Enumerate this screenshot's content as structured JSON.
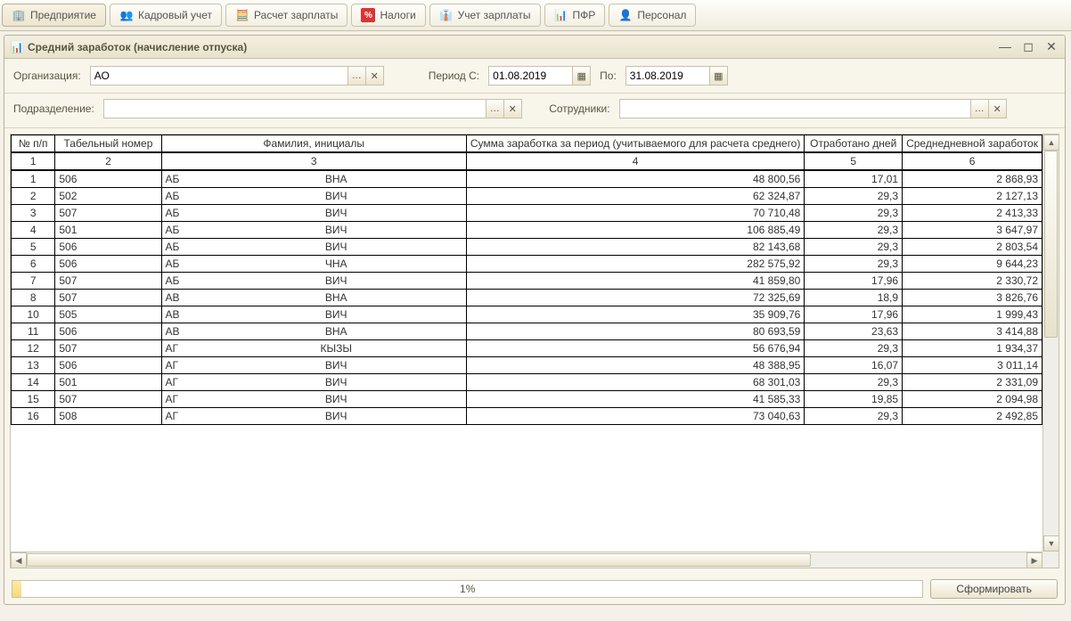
{
  "tabs": [
    {
      "label": "Предприятие",
      "icon": "🏢"
    },
    {
      "label": "Кадровый учет",
      "icon": "👥"
    },
    {
      "label": "Расчет зарплаты",
      "icon": "🧮"
    },
    {
      "label": "Налоги",
      "icon": "%"
    },
    {
      "label": "Учет зарплаты",
      "icon": "👔"
    },
    {
      "label": "ПФР",
      "icon": "📊"
    },
    {
      "label": "Персонал",
      "icon": "👤"
    }
  ],
  "window": {
    "title": "Средний заработок (начисление отпуска)"
  },
  "filters": {
    "org_label": "Организация:",
    "org_value": "АО",
    "period_from_label": "Период С:",
    "period_from": "01.08.2019",
    "period_to_label": "По:",
    "period_to": "31.08.2019",
    "dept_label": "Подразделение:",
    "dept_value": "",
    "emp_label": "Сотрудники:",
    "emp_value": ""
  },
  "table": {
    "headers": {
      "n": "№ п/п",
      "tab": "Табельный номер",
      "fio": "Фамилия, инициалы",
      "sum": "Сумма заработка за период (учитываемого для расчета среднего)",
      "days": "Отработано дней",
      "avg": "Среднедневной заработок"
    },
    "colnums": [
      "1",
      "2",
      "3",
      "4",
      "5",
      "6"
    ],
    "rows": [
      {
        "n": "1",
        "tab": "506",
        "f1": "АБ",
        "f2": "ВНА",
        "sum": "48 800,56",
        "days": "17,01",
        "avg": "2 868,93"
      },
      {
        "n": "2",
        "tab": "502",
        "f1": "АБ",
        "f2": "ВИЧ",
        "sum": "62 324,87",
        "days": "29,3",
        "avg": "2 127,13"
      },
      {
        "n": "3",
        "tab": "507",
        "f1": "АБ",
        "f2": "ВИЧ",
        "sum": "70 710,48",
        "days": "29,3",
        "avg": "2 413,33"
      },
      {
        "n": "4",
        "tab": "501",
        "f1": "АБ",
        "f2": "ВИЧ",
        "sum": "106 885,49",
        "days": "29,3",
        "avg": "3 647,97"
      },
      {
        "n": "5",
        "tab": "506",
        "f1": "АБ",
        "f2": "ВИЧ",
        "sum": "82 143,68",
        "days": "29,3",
        "avg": "2 803,54"
      },
      {
        "n": "6",
        "tab": "506",
        "f1": "АБ",
        "f2": "ЧНА",
        "sum": "282 575,92",
        "days": "29,3",
        "avg": "9 644,23"
      },
      {
        "n": "7",
        "tab": "507",
        "f1": "АБ",
        "f2": "ВИЧ",
        "sum": "41 859,80",
        "days": "17,96",
        "avg": "2 330,72"
      },
      {
        "n": "8",
        "tab": "507",
        "f1": "АВ",
        "f2": "ВНА",
        "sum": "72 325,69",
        "days": "18,9",
        "avg": "3 826,76"
      },
      {
        "n": "10",
        "tab": "505",
        "f1": "АВ",
        "f2": "ВИЧ",
        "sum": "35 909,76",
        "days": "17,96",
        "avg": "1 999,43"
      },
      {
        "n": "11",
        "tab": "506",
        "f1": "АВ",
        "f2": "ВНА",
        "sum": "80 693,59",
        "days": "23,63",
        "avg": "3 414,88"
      },
      {
        "n": "12",
        "tab": "507",
        "f1": "АГ",
        "f2": "КЫЗЫ",
        "sum": "56 676,94",
        "days": "29,3",
        "avg": "1 934,37"
      },
      {
        "n": "13",
        "tab": "506",
        "f1": "АГ",
        "f2": "ВИЧ",
        "sum": "48 388,95",
        "days": "16,07",
        "avg": "3 011,14"
      },
      {
        "n": "14",
        "tab": "501",
        "f1": "АГ",
        "f2": "ВИЧ",
        "sum": "68 301,03",
        "days": "29,3",
        "avg": "2 331,09"
      },
      {
        "n": "15",
        "tab": "507",
        "f1": "АГ",
        "f2": "ВИЧ",
        "sum": "41 585,33",
        "days": "19,85",
        "avg": "2 094,98"
      },
      {
        "n": "16",
        "tab": "508",
        "f1": "АГ",
        "f2": "ВИЧ",
        "sum": "73 040,63",
        "days": "29,3",
        "avg": "2 492,85"
      }
    ]
  },
  "footer": {
    "progress": "1%",
    "generate": "Сформировать"
  }
}
